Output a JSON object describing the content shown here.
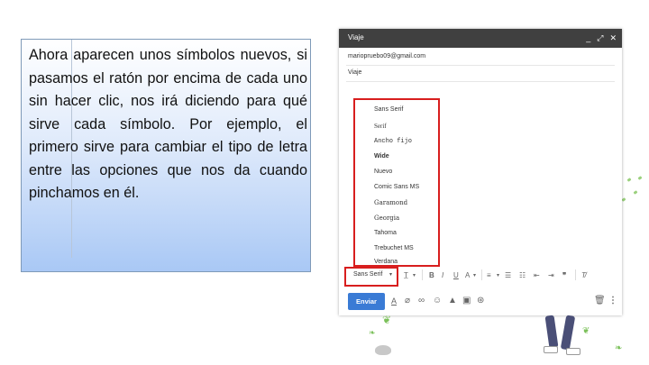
{
  "slide": {
    "paragraph": "Ahora aparecen unos símbolos nuevos, si pasamos el ratón por encima de cada uno sin hacer clic, nos irá diciendo para qué sirve cada símbolo. Por ejemplo, el primero sirve para cambiar el tipo de letra entre las opciones que nos da cuando pinchamos en él."
  },
  "compose": {
    "title": "Viaje",
    "header_icons": [
      "minimize-icon",
      "expand-icon",
      "close-icon"
    ],
    "header_glyphs": [
      "_",
      "⤢",
      "✕"
    ],
    "to": "mariopruebo09@gmail.com",
    "subject": "Viaje",
    "font_menu": [
      "Sans Serif",
      "Serif",
      "Ancho fijo",
      "Wide",
      "Nuevo",
      "Comic Sans MS",
      "Garamond",
      "Georgia",
      "Tahoma",
      "Trebuchet MS",
      "Verdana"
    ],
    "selected_font": "Sans Serif",
    "send_label": "Enviar"
  },
  "colors": {
    "send": "#3a7bd5",
    "highlight": "#d81e1e",
    "header": "#404040"
  }
}
